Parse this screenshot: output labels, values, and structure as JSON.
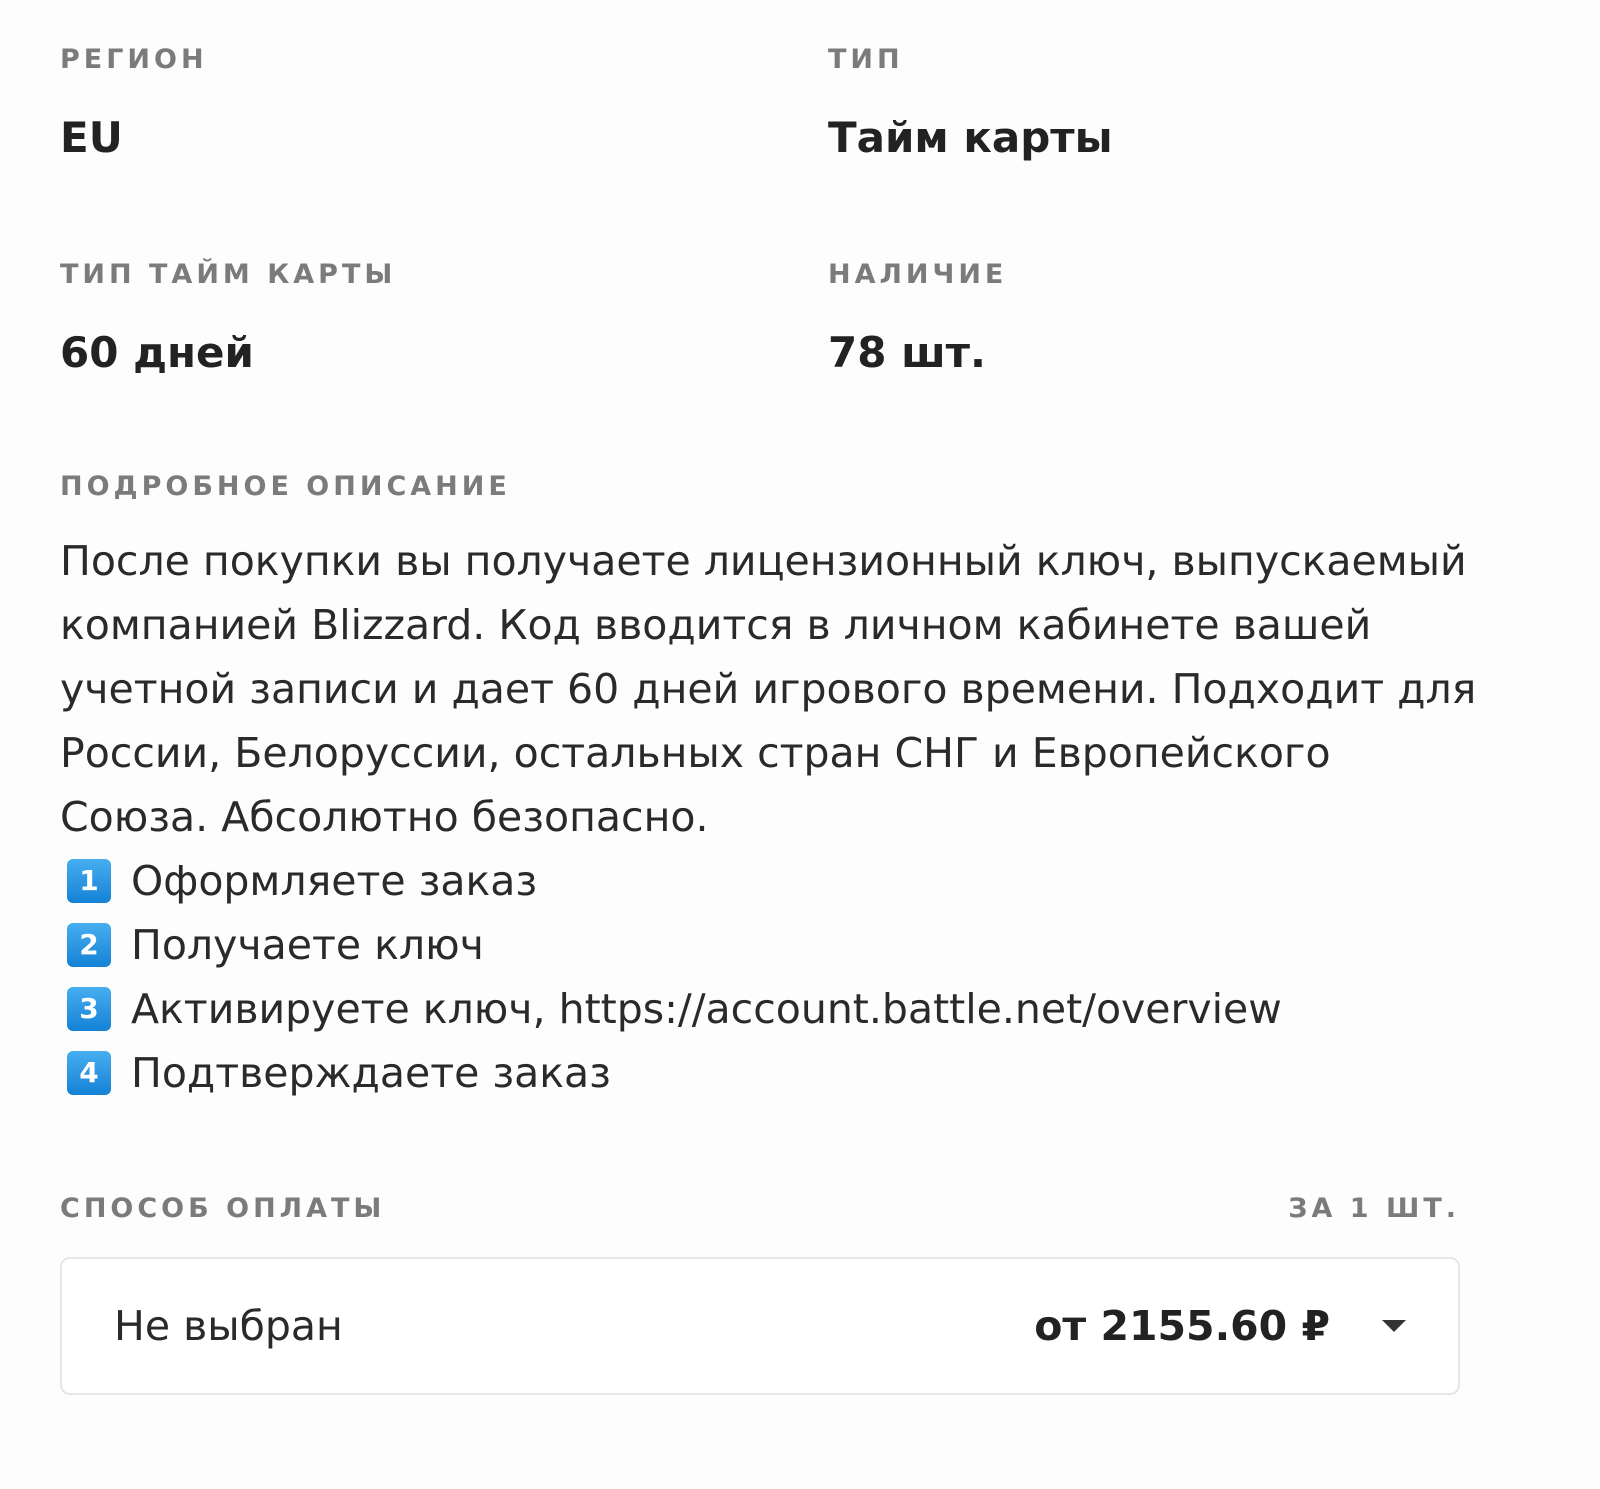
{
  "details": {
    "region": {
      "label": "РЕГИОН",
      "value": "EU"
    },
    "type": {
      "label": "ТИП",
      "value": "Тайм карты"
    },
    "card_type": {
      "label": "ТИП ТАЙМ КАРТЫ",
      "value": "60 дней"
    },
    "stock": {
      "label": "НАЛИЧИЕ",
      "value": "78 шт."
    }
  },
  "description": {
    "label": "ПОДРОБНОЕ ОПИСАНИЕ",
    "text": "После покупки вы получаете лицензионный ключ, выпускаемый компанией Blizzard. Код вводится в личном кабинете вашей учетной записи и дает 60 дней игрового времени. Подходит для России, Белоруссии, остальных стран СНГ и Европейского Союза. Абсолютно безопасно.",
    "steps": [
      {
        "badge": "1",
        "text": "Оформляете заказ"
      },
      {
        "badge": "2",
        "text": "Получаете ключ"
      },
      {
        "badge": "3",
        "text": "Активируете ключ, https://account.battle.net/overview"
      },
      {
        "badge": "4",
        "text": "Подтверждаете заказ"
      }
    ],
    "badge_color": "#1e8fe0"
  },
  "payment": {
    "label": "СПОСОБ ОПЛАТЫ",
    "per_unit": "ЗА 1 ШТ.",
    "selected_method": "Не выбран",
    "price": "от 2155.60 ₽",
    "dropdown_icon": "caret-down-icon"
  }
}
